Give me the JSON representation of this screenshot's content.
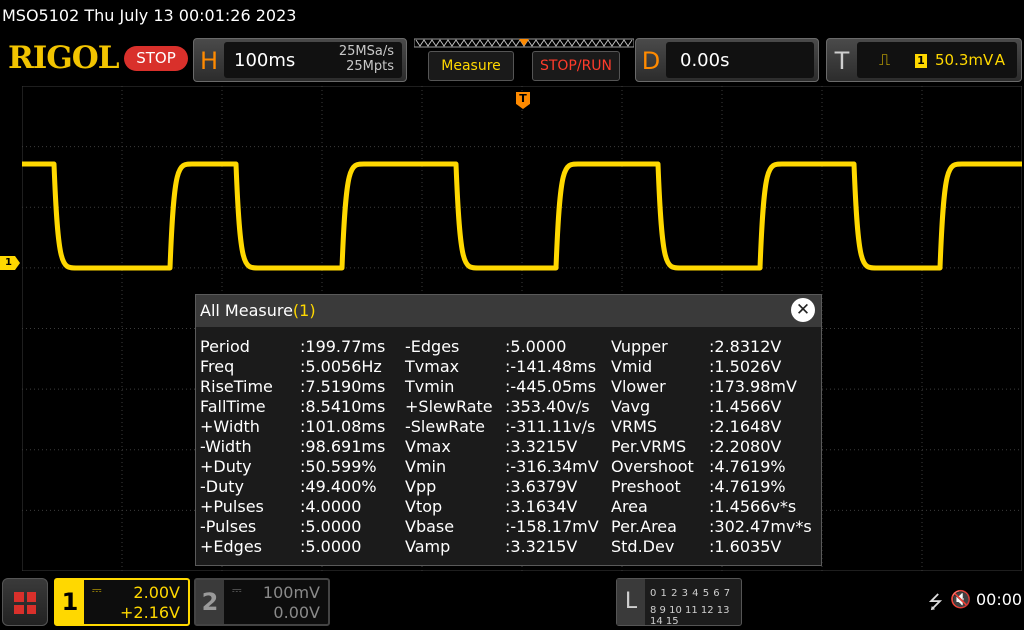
{
  "status": {
    "text": "MSO5102  Thu July 13 00:01:26 2023"
  },
  "toolbar": {
    "logo": "RIGOL",
    "run_state": "STOP",
    "horizontal": {
      "letter": "H",
      "timebase": "100ms",
      "sample_rate": "25MSa/s",
      "memory_depth": "25Mpts"
    },
    "measure_label": "Measure",
    "stoprun_label": "STOP/RUN",
    "delay": {
      "letter": "D",
      "value": "0.00s"
    },
    "trigger": {
      "letter": "T",
      "edge_icon": "rising-edge-icon",
      "source": "1",
      "level": "50.3mV",
      "mode": "A"
    }
  },
  "waveform": {
    "trigger_marker": "T",
    "ch1_marker": "1",
    "colors": {
      "ch1": "#ffd800",
      "grid": "#3c3c3c",
      "accent": "#ff8a00"
    }
  },
  "measure_dialog": {
    "title": "All Measure",
    "channel": "(1)",
    "close_icon": "close-icon",
    "columns": [
      [
        {
          "name": "Period",
          "value": ":199.77ms"
        },
        {
          "name": "Freq",
          "value": ":5.0056Hz"
        },
        {
          "name": "RiseTime",
          "value": ":7.5190ms"
        },
        {
          "name": "FallTime",
          "value": ":8.5410ms"
        },
        {
          "name": "+Width",
          "value": ":101.08ms"
        },
        {
          "name": "-Width",
          "value": ":98.691ms"
        },
        {
          "name": "+Duty",
          "value": ":50.599%"
        },
        {
          "name": "-Duty",
          "value": ":49.400%"
        },
        {
          "name": "+Pulses",
          "value": ":4.0000"
        },
        {
          "name": "-Pulses",
          "value": ":5.0000"
        },
        {
          "name": "+Edges",
          "value": ":5.0000"
        }
      ],
      [
        {
          "name": "-Edges",
          "value": ":5.0000"
        },
        {
          "name": "Tvmax",
          "value": ":-141.48ms"
        },
        {
          "name": "Tvmin",
          "value": ":-445.05ms"
        },
        {
          "name": "+SlewRate",
          "value": ":353.40v/s"
        },
        {
          "name": "-SlewRate",
          "value": ":-311.11v/s"
        },
        {
          "name": "Vmax",
          "value": ":3.3215V"
        },
        {
          "name": "Vmin",
          "value": ":-316.34mV"
        },
        {
          "name": "Vpp",
          "value": ":3.6379V"
        },
        {
          "name": "Vtop",
          "value": ":3.1634V"
        },
        {
          "name": "Vbase",
          "value": ":-158.17mV"
        },
        {
          "name": "Vamp",
          "value": ":3.3215V"
        }
      ],
      [
        {
          "name": "Vupper",
          "value": ":2.8312V"
        },
        {
          "name": "Vmid",
          "value": ":1.5026V"
        },
        {
          "name": "Vlower",
          "value": ":173.98mV"
        },
        {
          "name": "Vavg",
          "value": ":1.4566V"
        },
        {
          "name": "VRMS",
          "value": ":2.1648V"
        },
        {
          "name": "Per.VRMS",
          "value": ":2.2080V"
        },
        {
          "name": "Overshoot",
          "value": ":4.7619%"
        },
        {
          "name": "Preshoot",
          "value": ":4.7619%"
        },
        {
          "name": "Area",
          "value": ":1.4566v*s"
        },
        {
          "name": "Per.Area",
          "value": ":302.47mv*s"
        },
        {
          "name": "Std.Dev",
          "value": ":1.6035V"
        }
      ]
    ]
  },
  "bottom": {
    "menu_icon": "grid-menu-icon",
    "ch1": {
      "num": "1",
      "scale": "2.00V",
      "offset": "+2.16V"
    },
    "ch2": {
      "num": "2",
      "scale": "100mV",
      "offset": "0.00V"
    },
    "la": {
      "letter": "L",
      "row1": "0 1 2 3   4 5 6 7",
      "row2": "8 9 10 11  12 13 14 15"
    },
    "usb_icon": "usb-icon",
    "mute_icon": "speaker-mute-icon",
    "clock": "00:00"
  }
}
